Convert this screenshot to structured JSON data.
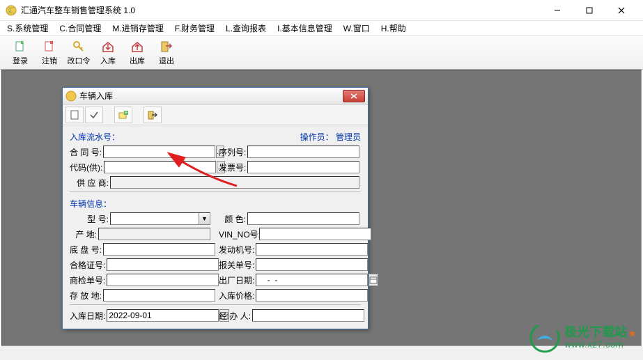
{
  "app": {
    "title": "汇通汽车整车销售管理系统 1.0"
  },
  "menu": [
    "S.系统管理",
    "C.合同管理",
    "M.进销存管理",
    "F.财务管理",
    "L.查询报表",
    "I.基本信息管理",
    "W.窗口",
    "H.帮助"
  ],
  "toolbar": [
    {
      "label": "登录",
      "icon": "login"
    },
    {
      "label": "注销",
      "icon": "logout"
    },
    {
      "label": "改口令",
      "icon": "key"
    },
    {
      "label": "入库",
      "icon": "in"
    },
    {
      "label": "出库",
      "icon": "out"
    },
    {
      "label": "退出",
      "icon": "exit"
    }
  ],
  "dialog": {
    "title": "车辆入库",
    "toolbar_buttons": [
      "new",
      "check",
      "add-field",
      "exit-field"
    ],
    "header": {
      "serial_label": "入库流水号：",
      "operator_label": "操作员：",
      "operator_value": "管理员"
    },
    "fields_top": {
      "contract_no": "合 同 号:",
      "serial_no": "序列号:",
      "supplier_code": "代码(供):",
      "invoice_no": "发票号:",
      "supplier_name": "供 应 商:"
    },
    "vehicle_section_title": "车辆信息：",
    "fields_vehicle": {
      "model": "型    号:",
      "color": "颜    色:",
      "origin": "产    地:",
      "vin": "VIN_NO号:",
      "chassis": "底 盘 号:",
      "engine": "发动机号:",
      "cert_no": "合格证号:",
      "customs_no": "报关单号:",
      "inspect_no": "商检单号:",
      "factory_date": "出厂日期:",
      "factory_date_value": "    -  -",
      "storage_loc": "存 放 地:",
      "in_price": "入库价格:",
      "in_date": "入库日期:",
      "in_date_value": "2022-09-01",
      "handler": "经 办 人:"
    }
  },
  "watermark": {
    "name": "极光下载站",
    "url": "www.xz7.com"
  }
}
